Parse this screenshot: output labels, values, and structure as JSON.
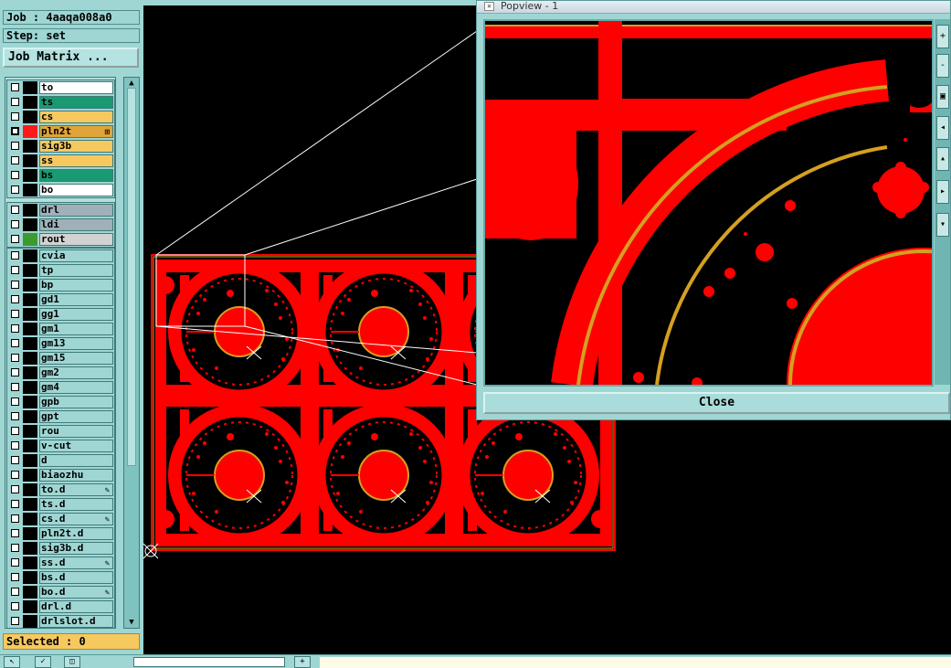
{
  "job_label": "Job : 4aaqa008a0",
  "step_label": "Step: set",
  "job_matrix_button": "Job Matrix ...",
  "layer_groups": [
    {
      "layers": [
        {
          "name": "to",
          "color": "#ffffff",
          "swatch": "#000000",
          "checked": false
        },
        {
          "name": "ts",
          "color": "#1a9a72",
          "swatch": "#000000",
          "checked": false
        },
        {
          "name": "cs",
          "color": "#f6c960",
          "swatch": "#000000",
          "checked": false
        },
        {
          "name": "pln2t",
          "color": "#e0a43a",
          "swatch": "#ff1a1a",
          "checked": true,
          "mark": "⊞"
        },
        {
          "name": "sig3b",
          "color": "#f6c960",
          "swatch": "#000000",
          "checked": false
        },
        {
          "name": "ss",
          "color": "#f6c960",
          "swatch": "#000000",
          "checked": false
        },
        {
          "name": "bs",
          "color": "#1a9a72",
          "swatch": "#000000",
          "checked": false
        },
        {
          "name": "bo",
          "color": "#ffffff",
          "swatch": "#000000",
          "checked": false
        }
      ]
    },
    {
      "layers": [
        {
          "name": "drl",
          "color": "#9fb0b8",
          "swatch": "#000000",
          "checked": false
        },
        {
          "name": "ldi",
          "color": "#9fb0b8",
          "swatch": "#000000",
          "checked": false
        },
        {
          "name": "rout",
          "color": "#d2d2d2",
          "swatch": "#3c9a2e",
          "checked": false
        }
      ]
    },
    {
      "layers": [
        {
          "name": "cvia",
          "color": "#9fd6d4",
          "swatch": "#000000",
          "checked": false
        },
        {
          "name": "tp",
          "color": "#9fd6d4",
          "swatch": "#000000",
          "checked": false
        },
        {
          "name": "bp",
          "color": "#9fd6d4",
          "swatch": "#000000",
          "checked": false
        },
        {
          "name": "gd1",
          "color": "#9fd6d4",
          "swatch": "#000000",
          "checked": false
        },
        {
          "name": "gg1",
          "color": "#9fd6d4",
          "swatch": "#000000",
          "checked": false
        },
        {
          "name": "gm1",
          "color": "#9fd6d4",
          "swatch": "#000000",
          "checked": false
        },
        {
          "name": "gm13",
          "color": "#9fd6d4",
          "swatch": "#000000",
          "checked": false
        },
        {
          "name": "gm15",
          "color": "#9fd6d4",
          "swatch": "#000000",
          "checked": false
        },
        {
          "name": "gm2",
          "color": "#9fd6d4",
          "swatch": "#000000",
          "checked": false
        },
        {
          "name": "gm4",
          "color": "#9fd6d4",
          "swatch": "#000000",
          "checked": false
        },
        {
          "name": "gpb",
          "color": "#9fd6d4",
          "swatch": "#000000",
          "checked": false
        },
        {
          "name": "gpt",
          "color": "#9fd6d4",
          "swatch": "#000000",
          "checked": false
        },
        {
          "name": "rou",
          "color": "#9fd6d4",
          "swatch": "#000000",
          "checked": false
        },
        {
          "name": "v-cut",
          "color": "#9fd6d4",
          "swatch": "#000000",
          "checked": false
        },
        {
          "name": "d",
          "color": "#9fd6d4",
          "swatch": "#000000",
          "checked": false
        },
        {
          "name": "biaozhu",
          "color": "#9fd6d4",
          "swatch": "#000000",
          "checked": false
        },
        {
          "name": "to.d",
          "color": "#9fd6d4",
          "swatch": "#000000",
          "checked": false,
          "mark": "✎"
        },
        {
          "name": "ts.d",
          "color": "#9fd6d4",
          "swatch": "#000000",
          "checked": false
        },
        {
          "name": "cs.d",
          "color": "#9fd6d4",
          "swatch": "#000000",
          "checked": false,
          "mark": "✎"
        },
        {
          "name": "pln2t.d",
          "color": "#9fd6d4",
          "swatch": "#000000",
          "checked": false
        },
        {
          "name": "sig3b.d",
          "color": "#9fd6d4",
          "swatch": "#000000",
          "checked": false
        },
        {
          "name": "ss.d",
          "color": "#9fd6d4",
          "swatch": "#000000",
          "checked": false,
          "mark": "✎"
        },
        {
          "name": "bs.d",
          "color": "#9fd6d4",
          "swatch": "#000000",
          "checked": false
        },
        {
          "name": "bo.d",
          "color": "#9fd6d4",
          "swatch": "#000000",
          "checked": false,
          "mark": "✎"
        },
        {
          "name": "drl.d",
          "color": "#9fd6d4",
          "swatch": "#000000",
          "checked": false
        },
        {
          "name": "drlslot.d",
          "color": "#9fd6d4",
          "swatch": "#000000",
          "checked": false
        }
      ]
    }
  ],
  "selected_label": "Selected : 0",
  "popview": {
    "title": "Popview - 1",
    "close_label": "Close"
  },
  "colors": {
    "copper": "#ff0000",
    "outline": "#d4a020",
    "panel": "#9fd6d4"
  }
}
